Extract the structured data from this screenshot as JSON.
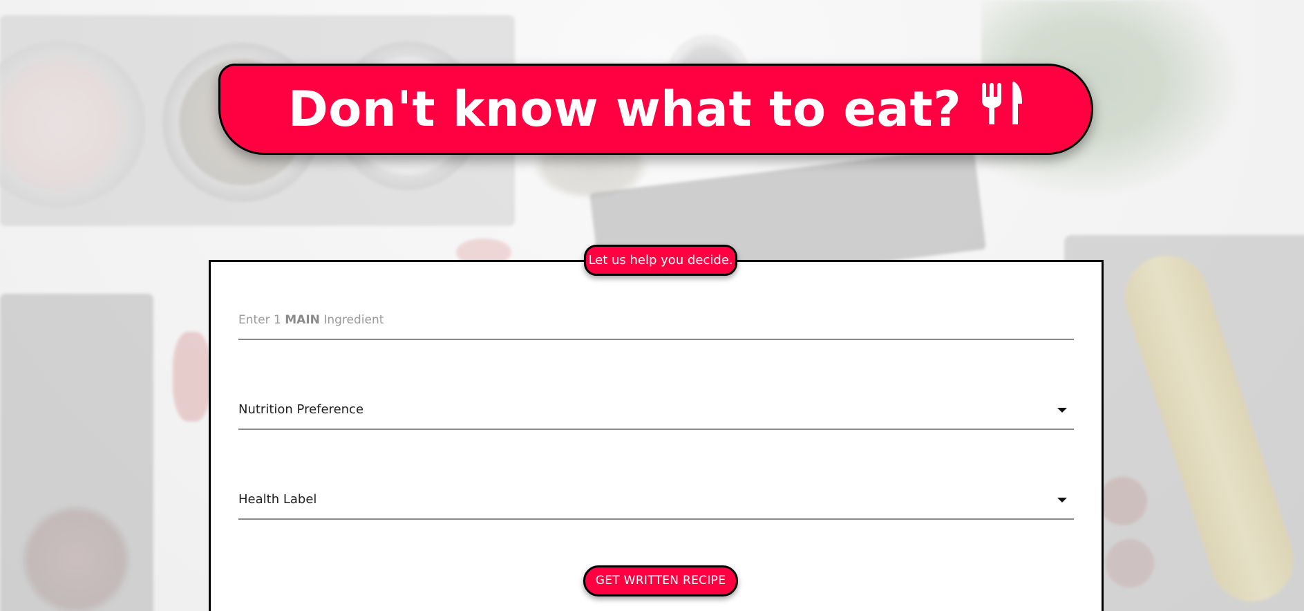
{
  "header": {
    "title": "Don't know what to eat?",
    "icon": "utensils-icon"
  },
  "form": {
    "tagline": "Let us help you decide.",
    "ingredient": {
      "placeholder_prefix": "Enter 1",
      "placeholder_emphasis": "MAIN",
      "placeholder_suffix": "Ingredient",
      "value": ""
    },
    "nutrition_select": {
      "label": "Nutrition Preference",
      "icon": "chevron-down-icon"
    },
    "health_select": {
      "label": "Health Label",
      "icon": "chevron-down-icon"
    },
    "submit_label": "GET WRITTEN RECIPE"
  },
  "colors": {
    "accent": "#ff0040",
    "border": "#000000",
    "card": "#ffffff"
  }
}
